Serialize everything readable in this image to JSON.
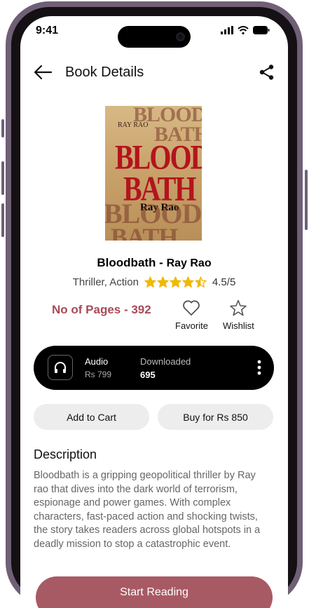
{
  "status_bar": {
    "time": "9:41"
  },
  "header": {
    "title": "Book Details"
  },
  "cover": {
    "author": "RAY RAO",
    "title_line1": "BLOOD",
    "title_line2": "BATH",
    "author_large": "Ray Rao",
    "bg_top": "BLOOD",
    "bg_top2": "BATH",
    "bg_bottom": "BLOOD",
    "bg_bottom2": "BATH"
  },
  "book": {
    "title": "Bloodbath",
    "separator": " - ",
    "author": "Ray Rao",
    "genres": "Thriller, Action",
    "rating_text": "4.5/5",
    "rating_value": 4.5,
    "rating_max": 5,
    "pages_text": "No of Pages - 392"
  },
  "actions": {
    "favorite_label": "Favorite",
    "wishlist_label": "Wishlist"
  },
  "audio": {
    "label": "Audio",
    "price": "Rs 799",
    "downloaded_label": "Downloaded",
    "downloaded_count": "695"
  },
  "buttons": {
    "add_to_cart": "Add to Cart",
    "buy": "Buy for Rs 850",
    "start": "Start Reading"
  },
  "description": {
    "heading": "Description",
    "text": "Bloodbath is a gripping geopolitical thriller by Ray rao that dives into the dark world of terrorism, espionage and power games. With complex characters, fast-paced action and shocking twists, the story takes readers across global hotspots in a deadly mission to stop a catastrophic event."
  },
  "colors": {
    "accent": "#a84a57",
    "star": "#f2b705",
    "frame": "#6f6075"
  },
  "icons": [
    "back-arrow-icon",
    "share-icon",
    "heart-icon",
    "star-icon",
    "headphones-icon",
    "more-vertical-icon"
  ]
}
